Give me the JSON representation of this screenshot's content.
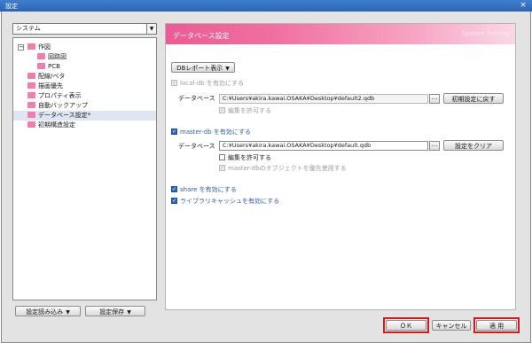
{
  "window": {
    "title": "設定",
    "close_glyph": "×"
  },
  "left": {
    "category": "システム",
    "tree": [
      {
        "label": "作図",
        "level": 0,
        "expander": "⊟"
      },
      {
        "label": "図路図",
        "level": 1
      },
      {
        "label": "PCB",
        "level": 1
      },
      {
        "label": "配線/ベタ",
        "level": 0
      },
      {
        "label": "描画優先",
        "level": 0
      },
      {
        "label": "プロパティ表示",
        "level": 0
      },
      {
        "label": "自動バックアップ",
        "level": 0
      },
      {
        "label": "データベース設定*",
        "level": 0,
        "selected": true
      },
      {
        "label": "初期構造設定",
        "level": 0
      }
    ],
    "load_button": "設定読み込み",
    "save_button": "設定保存"
  },
  "banner": {
    "title": "データベース設定",
    "subtitle": "System Setting"
  },
  "db": {
    "report_button": "DBレポート表示",
    "local_enable": "local-db を有効にする",
    "local_db_label": "データベース",
    "local_path": "C:¥Users¥akira.kawai.OSAKA¥Desktop¥default2.qdb",
    "local_edit": "編集を許可する",
    "reset_button": "初期設定に戻す",
    "master_enable": "master-db を有効にする",
    "master_db_label": "データベース",
    "master_path": "C:¥Users¥akira.kawai.OSAKA¥Desktop¥default.qdb",
    "master_edit": "編集を許可する",
    "master_priority": "master-dbのオブジェクトを優先使用する",
    "clear_button": "設定をクリア",
    "share_enable": "share を有効にする",
    "cache_enable": "ライブラリキャッシュを有効にする",
    "dots": "…"
  },
  "footer": {
    "ok": "ＯＫ",
    "cancel": "キャンセル",
    "apply": "適 用"
  },
  "colors": {
    "accent": "#2a6ac6",
    "banner": "#ec5b95",
    "highlight": "#d21b1b"
  }
}
